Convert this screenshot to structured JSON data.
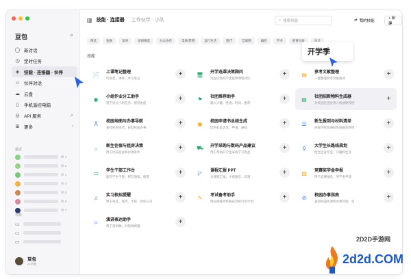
{
  "sidebar": {
    "brand": "豆包",
    "nav": [
      {
        "label": "新对话",
        "icon": "chat-icon"
      },
      {
        "label": "定时任务",
        "icon": "clock-icon"
      },
      {
        "label": "技能 · 连接器 · 伙伴",
        "icon": "layers-icon"
      },
      {
        "label": "伙伴对话",
        "icon": "people-icon"
      },
      {
        "label": "云盘",
        "icon": "cloud-icon"
      },
      {
        "label": "手机遥控电脑",
        "icon": "phone-icon"
      },
      {
        "label": "API 服务",
        "icon": "api-icon"
      },
      {
        "label": "更多",
        "icon": "grid-icon"
      }
    ],
    "recent_label": "最近",
    "recent_counts": [
      "⌘ 1",
      "⌘ 2",
      "⌘ 3",
      "⌘ 4",
      "⌘ 5",
      "⌘ 6",
      "⌘ 7"
    ],
    "groups_label": "项目",
    "user": {
      "name": "豆包",
      "status": "Ai学者"
    }
  },
  "header": {
    "title": "技能 · 连接器",
    "subtitle": "工作伙伴 · 小队",
    "search_placeholder": "搜索技能",
    "my_skills": "我的技能",
    "new": "+ 新建"
  },
  "categories": [
    "精选",
    "金融",
    "法律",
    "投研精选",
    "办公协作",
    "电商/营销",
    "运行生活",
    "医疗",
    "互联网",
    "编程",
    "学术",
    "教育科技",
    "设计"
  ],
  "callout": "开学季",
  "section_title": "技能",
  "cards": [
    {
      "title": "上课笔记整理",
      "desc": "听录音，课件，手写笔记",
      "icon": "📄",
      "color": "#3b7cf0",
      "hl": false
    },
    {
      "title": "开学选课决策顾问",
      "desc": "为国内高校学生提供课程对比",
      "icon": "🖥",
      "color": "#2aa36a",
      "hl": false
    },
    {
      "title": "参考文献整理",
      "desc": "一键整理参考文献格式",
      "icon": "▤",
      "color": "#f5a623",
      "hl": false
    },
    {
      "title": "小组作业分工助手",
      "desc": "用于拆分小组任务，规划进度",
      "icon": "◉",
      "color": "#2aa36a",
      "hl": false
    },
    {
      "title": "社团推荐助手",
      "desc": "输入兴趣、性格、时间，推荐",
      "icon": "⚑",
      "color": "#2aa36a",
      "hl": false
    },
    {
      "title": "社团招新物料生成器",
      "desc": "为校园社团负责人快速制作招",
      "icon": "▤",
      "color": "#2aa36a",
      "hl": true
    },
    {
      "title": "校园地图与办事导航",
      "desc": "查找校内地点，获取校园办事",
      "icon": "Ä",
      "color": "#3b7cf0",
      "hl": false
    },
    {
      "title": "校园申请书总结生成",
      "desc": "因色彩是诉求，申请、通知",
      "icon": "▣",
      "color": "#f5a623",
      "hl": false
    },
    {
      "title": "新生报到与材料清单",
      "desc": "依据学校新通知生成报到清单",
      "icon": "☰",
      "color": "#3b7cf0",
      "hl": false
    },
    {
      "title": "新生住宿与租房决策",
      "desc": "用于比较宿舍和房源条件",
      "icon": "⌂",
      "color": "#3b7cf0",
      "hl": false
    },
    {
      "title": "开学采购与数码产品建议",
      "desc": "用于帮助开学生采购学习用品",
      "icon": "⛟",
      "color": "#2aa36a",
      "hl": false
    },
    {
      "title": "大学生长路线规划",
      "desc": "结合自身专业，兴趣和生涯",
      "icon": "⚲",
      "color": "#3b7cf0",
      "hl": false
    },
    {
      "title": "学生干部工作台",
      "desc": "面向学生干部，把写通知，摸底",
      "icon": "▭",
      "color": "#2aa36a",
      "hl": false
    },
    {
      "title": "课程汇报 PPT",
      "desc": "为课程汇报，小组展示，结课",
      "icon": "◸",
      "color": "#3b7cf0",
      "hl": false
    },
    {
      "title": "竞赛奖学金申报",
      "desc": "用于竞赛报名、奖学金申请",
      "icon": "▨",
      "color": "#f5a623",
      "hl": false
    },
    {
      "title": "实习校招提醒",
      "desc": "用于筛选，城市、年级、目标公司",
      "icon": "♫",
      "color": "#3b7cf0",
      "hl": false
    },
    {
      "title": "考试备考助手",
      "desc": "把长期备考拆解成可执行的计划",
      "icon": "✎",
      "color": "#f5a623",
      "hl": false
    },
    {
      "title": "校园办事指南",
      "desc": "查询校园资源和办事流程，生",
      "icon": "⊘",
      "color": "#3b7cf0",
      "hl": false
    },
    {
      "title": "演讲表达助手",
      "desc": "用于演讲稿，对现场梳理",
      "icon": "☺",
      "color": "#3b7cf0",
      "hl": false
    }
  ],
  "watermark": {
    "text": "2d2d.COM",
    "sub": "2D2D手游网"
  }
}
